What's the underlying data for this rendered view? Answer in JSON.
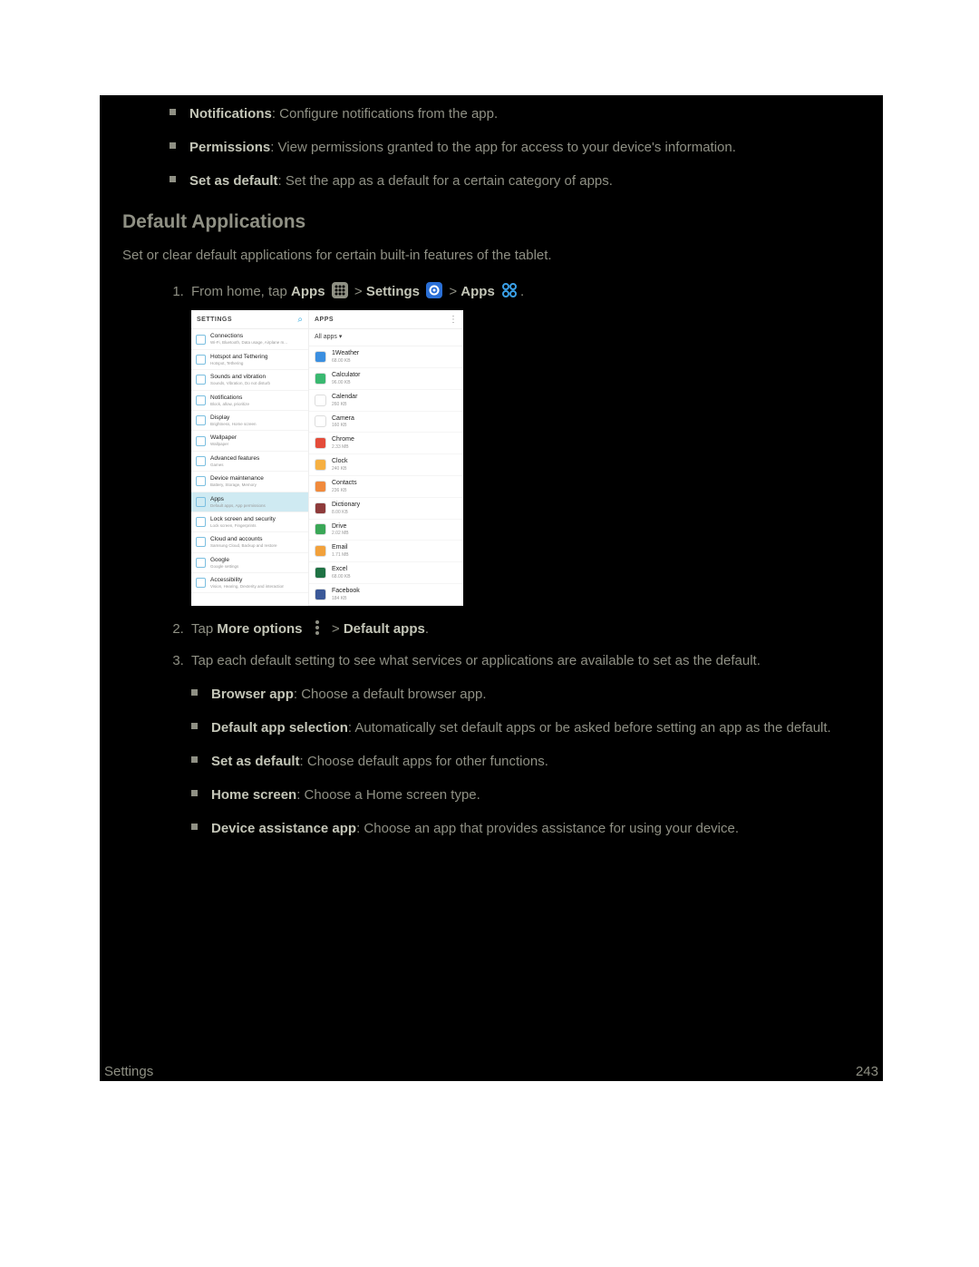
{
  "top_bullets": [
    {
      "term": "Notifications",
      "desc": ": Configure notifications from the app."
    },
    {
      "term": "Permissions",
      "desc": ": View permissions granted to the app for access to your device's information."
    },
    {
      "term": "Set as default",
      "desc": ": Set the app as a default for a certain category of apps."
    }
  ],
  "section_title": "Default Applications",
  "section_intro": "Set or clear default applications for certain built-in features of the tablet.",
  "step1": {
    "prefix": "From home, tap ",
    "apps_bold": "Apps",
    "sep": " > ",
    "settings_bold": "Settings",
    "apps2_bold": "Apps",
    "period": "."
  },
  "step2": {
    "prefix": "Tap ",
    "more_bold": "More options",
    "sep": " > ",
    "default_bold": "Default apps",
    "period": "."
  },
  "step3_text": "Tap each default setting to see what services or applications are available to set as the default.",
  "step3_bullets": [
    {
      "term": "Browser app",
      "desc": ": Choose a default browser app."
    },
    {
      "term": "Default app selection",
      "desc": ": Automatically set default apps or be asked before setting an app as the default."
    },
    {
      "term": "Set as default",
      "desc": ": Choose default apps for other functions."
    },
    {
      "term": "Home screen",
      "desc": ": Choose a Home screen type."
    },
    {
      "term": "Device assistance app",
      "desc": ": Choose an app that provides assistance for using your device."
    }
  ],
  "screenshot": {
    "left_title": "SETTINGS",
    "right_title": "APPS",
    "all_apps": "All apps ▾",
    "settings_list": [
      {
        "t": "Connections",
        "s": "Wi-Fi, Bluetooth, Data usage, Airplane m..."
      },
      {
        "t": "Hotspot and Tethering",
        "s": "Hotspot, Tethering"
      },
      {
        "t": "Sounds and vibration",
        "s": "Sounds, Vibration, Do not disturb"
      },
      {
        "t": "Notifications",
        "s": "Block, allow, prioritize"
      },
      {
        "t": "Display",
        "s": "Brightness, Home screen"
      },
      {
        "t": "Wallpaper",
        "s": "Wallpaper"
      },
      {
        "t": "Advanced features",
        "s": "Games"
      },
      {
        "t": "Device maintenance",
        "s": "Battery, Storage, Memory"
      },
      {
        "t": "Apps",
        "s": "Default apps, App permissions",
        "sel": true
      },
      {
        "t": "Lock screen and security",
        "s": "Lock screen, Fingerprints"
      },
      {
        "t": "Cloud and accounts",
        "s": "Samsung Cloud, Backup and restore"
      },
      {
        "t": "Google",
        "s": "Google settings"
      },
      {
        "t": "Accessibility",
        "s": "Vision, Hearing, Dexterity and interaction"
      }
    ],
    "apps_list": [
      {
        "t": "1Weather",
        "s": "68.00 KB",
        "c": "#3b8fe0"
      },
      {
        "t": "Calculator",
        "s": "96.00 KB",
        "c": "#39b870"
      },
      {
        "t": "Calendar",
        "s": "260 KB",
        "c": "#ffffff"
      },
      {
        "t": "Camera",
        "s": "160 KB",
        "c": "#ffffff"
      },
      {
        "t": "Chrome",
        "s": "2.33 MB",
        "c": "#e44c3a"
      },
      {
        "t": "Clock",
        "s": "240 KB",
        "c": "#f6b042"
      },
      {
        "t": "Contacts",
        "s": "236 KB",
        "c": "#f08a3c"
      },
      {
        "t": "Dictionary",
        "s": "8.00 KB",
        "c": "#8e3b3b"
      },
      {
        "t": "Drive",
        "s": "2.02 MB",
        "c": "#3aa757"
      },
      {
        "t": "Email",
        "s": "1.71 MB",
        "c": "#f2a13b"
      },
      {
        "t": "Excel",
        "s": "68.00 KB",
        "c": "#1f7244"
      },
      {
        "t": "Facebook",
        "s": "184 KB",
        "c": "#3b5998"
      }
    ]
  },
  "footer_left": "Settings",
  "footer_right": "243"
}
